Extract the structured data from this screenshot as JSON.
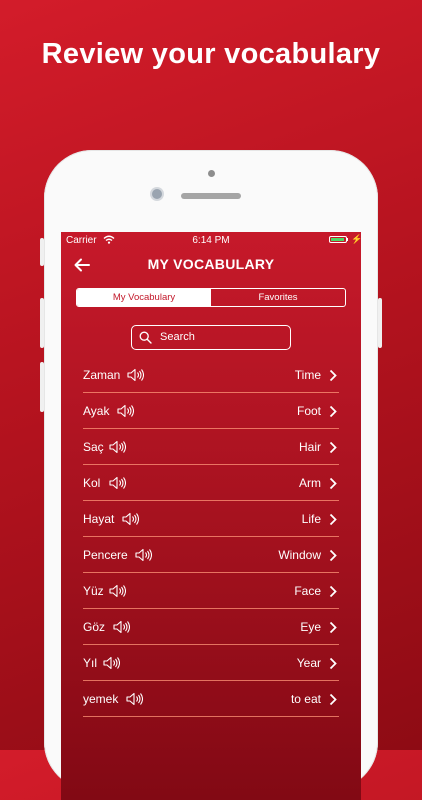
{
  "promo": {
    "title": "Review your vocabulary"
  },
  "status_bar": {
    "carrier": "Carrier",
    "time": "6:14 PM",
    "charging_icon": "bolt-icon"
  },
  "nav": {
    "title": "MY VOCABULARY",
    "back_icon": "back-arrow-icon"
  },
  "tabs": [
    {
      "label": "My Vocabulary",
      "active": true
    },
    {
      "label": "Favorites",
      "active": false
    }
  ],
  "search": {
    "placeholder": "Search",
    "icon": "search-icon"
  },
  "vocabulary": [
    {
      "word": "Zaman",
      "translation": "Time"
    },
    {
      "word": "Ayak",
      "translation": "Foot"
    },
    {
      "word": "Saç",
      "translation": "Hair"
    },
    {
      "word": "Kol",
      "translation": "Arm"
    },
    {
      "word": "Hayat",
      "translation": "Life"
    },
    {
      "word": "Pencere",
      "translation": "Window"
    },
    {
      "word": "Yüz",
      "translation": "Face"
    },
    {
      "word": "Göz",
      "translation": "Eye"
    },
    {
      "word": "Yıl",
      "translation": "Year"
    },
    {
      "word": "yemek",
      "translation": "to eat"
    }
  ],
  "colors": {
    "background": "#c1161f",
    "accent": "#c2182a",
    "battery": "#4cd964"
  }
}
